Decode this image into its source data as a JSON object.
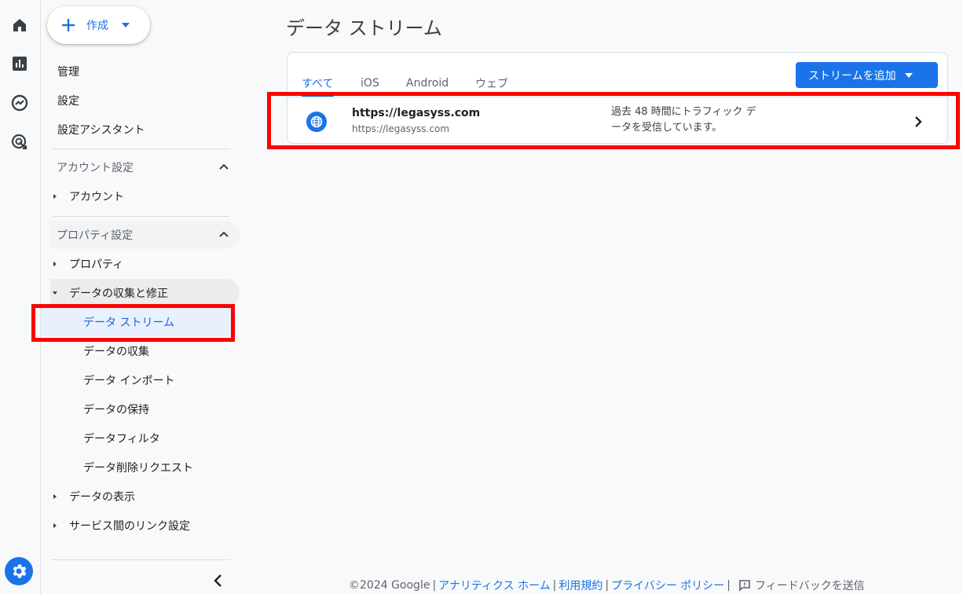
{
  "rail": {
    "icons": [
      "home-icon",
      "reports-icon",
      "explore-icon",
      "advertising-icon"
    ],
    "admin_icon": "gear-icon"
  },
  "nav": {
    "create_label": "作成",
    "top_items": [
      "管理",
      "設定",
      "設定アシスタント"
    ],
    "account_section": {
      "title": "アカウント設定",
      "items": [
        "アカウント"
      ]
    },
    "property_section": {
      "title": "プロパティ設定",
      "property_label": "プロパティ",
      "data_collection_label": "データの収集と修正",
      "sub_items": [
        "データ ストリーム",
        "データの収集",
        "データ インポート",
        "データの保持",
        "データフィルタ",
        "データ削除リクエスト"
      ],
      "active_sub_item": "データ ストリーム",
      "data_display_label": "データの表示",
      "service_link_label": "サービス間のリンク設定"
    }
  },
  "main": {
    "title": "データ ストリーム",
    "tabs": [
      "すべて",
      "iOS",
      "Android",
      "ウェブ"
    ],
    "active_tab": "すべて",
    "add_stream_label": "ストリームを追加",
    "streams": [
      {
        "name": "https://legasyss.com",
        "url": "https://legasyss.com",
        "status_line1": "過去 48 時間にトラフィック デ",
        "status_line2": "ータを受信しています。"
      }
    ]
  },
  "footer": {
    "copyright": "©2024 Google",
    "links": [
      "アナリティクス ホーム",
      "利用規約",
      "プライバシー ポリシー"
    ],
    "feedback": "フィードバックを送信"
  },
  "colors": {
    "accent": "#1a73e8",
    "highlight_box": "#ff0000",
    "active_nav_bg": "#e8f0fe"
  }
}
